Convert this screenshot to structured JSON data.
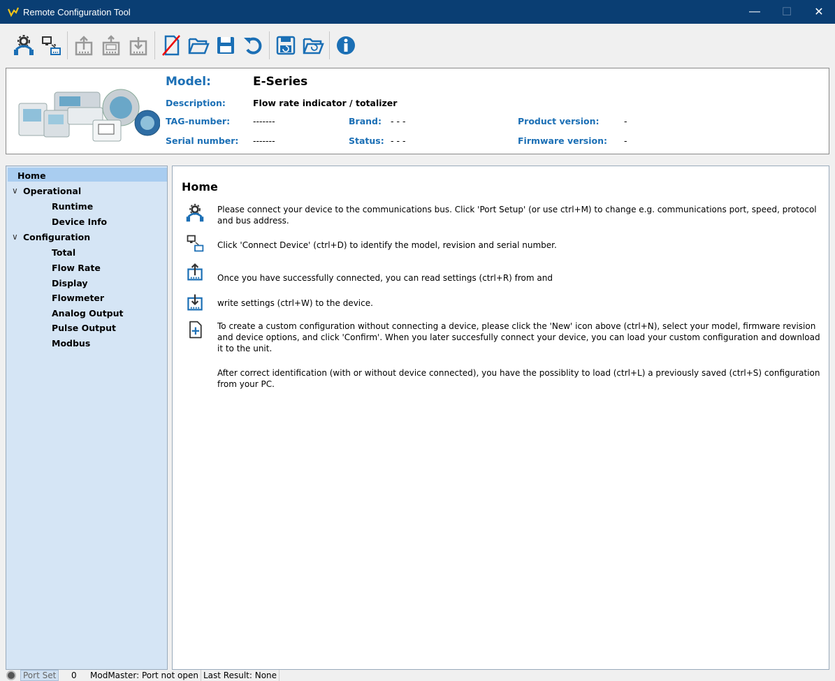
{
  "window": {
    "title": "Remote Configuration Tool",
    "minimize": "—",
    "maximize": "☐",
    "close": "✕"
  },
  "toolbar": {
    "items": [
      "port-setup-icon",
      "connect-device-icon",
      "read-settings-icon",
      "read-log-icon",
      "write-settings-icon",
      "new-config-icon",
      "open-folder-icon",
      "save-icon",
      "undo-icon",
      "save-pc-icon",
      "load-pc-icon",
      "info-icon"
    ]
  },
  "header": {
    "model_label": "Model:",
    "model_value": "E-Series",
    "description_label": "Description:",
    "description_value": "Flow rate indicator / totalizer",
    "tag_label": "TAG-number:",
    "tag_value": "-------",
    "serial_label": "Serial number:",
    "serial_value": "-------",
    "brand_label": "Brand:",
    "brand_value": "- - -",
    "status_label": "Status:",
    "status_value": "- - -",
    "product_label": "Product version:",
    "product_value": "-",
    "firmware_label": "Firmware version:",
    "firmware_value": "-"
  },
  "tree": {
    "home": "Home",
    "operational": "Operational",
    "runtime": "Runtime",
    "device_info": "Device Info",
    "configuration": "Configuration",
    "total": "Total",
    "flow_rate": "Flow Rate",
    "display": "Display",
    "flowmeter": "Flowmeter",
    "analog_output": "Analog Output",
    "pulse_output": "Pulse Output",
    "modbus": "Modbus",
    "chevron": "∨"
  },
  "main": {
    "heading": "Home",
    "p1": "Please connect your device to the communications bus. Click 'Port Setup' (or use ctrl+M) to change e.g. communications port, speed, protocol and bus address.",
    "p2": "Click 'Connect Device' (ctrl+D) to identify the model, revision and serial number.",
    "p3": "Once you have successfully connected, you can read settings (ctrl+R) from and",
    "p4": "write settings (ctrl+W) to the device.",
    "p5": "To create a custom configuration without connecting a device, please click the 'New' icon above (ctrl+N), select your model, firmware revision and device options, and click 'Confirm'. When you later succesfully connect your device, you can load your custom configuration and download it to the unit.",
    "p6": "After correct identification (with or without device connected), you have the possiblity to load (ctrl+L) a previously saved (ctrl+S) configuration from your PC."
  },
  "statusbar": {
    "port_setup": "Port Set",
    "count": "0",
    "modmaster": "ModMaster: Port not open",
    "last_result": "Last Result: None"
  }
}
